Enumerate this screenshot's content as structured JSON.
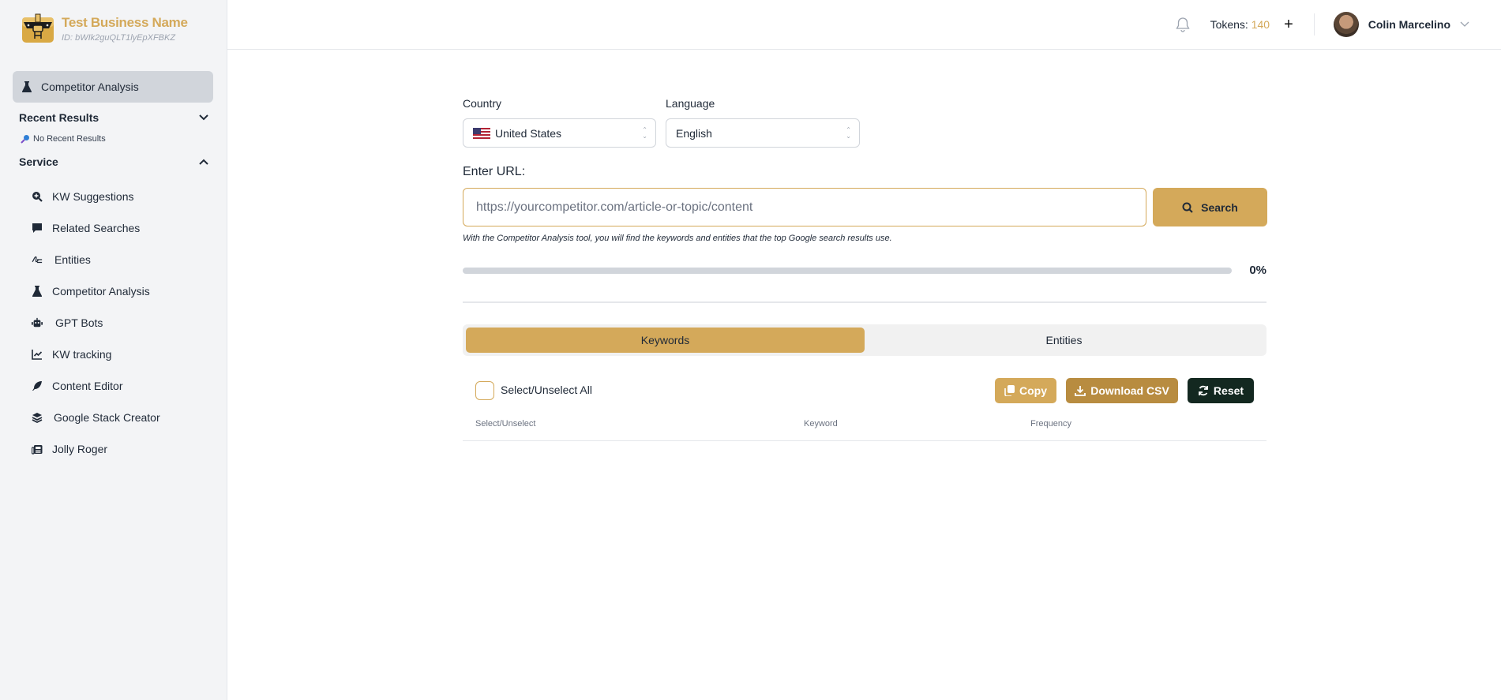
{
  "brand": {
    "name": "Test Business Name",
    "id_text": "ID: bWIk2guQLT1lyEpXFBKZ",
    "logo_icon": "treasure-chest-logo"
  },
  "sidebar": {
    "active_item": {
      "label": "Competitor Analysis",
      "icon": "flask-icon"
    },
    "recent_results": {
      "label": "Recent Results",
      "chevron": "chevron-down-icon",
      "empty_text": "No Recent Results",
      "empty_icon": "key-icon"
    },
    "service": {
      "label": "Service",
      "chevron": "chevron-up-icon"
    },
    "items": [
      {
        "label": "KW Suggestions",
        "icon": "search-plus-icon"
      },
      {
        "label": "Related Searches",
        "icon": "comment-icon"
      },
      {
        "label": "Entities",
        "icon": "signature-icon"
      },
      {
        "label": "Competitor Analysis",
        "icon": "flask-icon"
      },
      {
        "label": "GPT Bots",
        "icon": "robot-icon"
      },
      {
        "label": "KW tracking",
        "icon": "chart-line-icon"
      },
      {
        "label": "Content Editor",
        "icon": "feather-icon"
      },
      {
        "label": "Google Stack Creator",
        "icon": "layers-icon"
      },
      {
        "label": "Jolly Roger",
        "icon": "newspaper-icon"
      }
    ]
  },
  "header": {
    "tokens_label": "Tokens:",
    "tokens_value": "140",
    "user_name": "Colin Marcelino"
  },
  "form": {
    "country_label": "Country",
    "country_value": "United States",
    "language_label": "Language",
    "language_value": "English",
    "url_label": "Enter URL:",
    "url_placeholder": "https://yourcompetitor.com/article-or-topic/content",
    "url_value": "",
    "search_label": "Search",
    "hint": "With the Competitor Analysis tool, you will find the keywords and entities that the top Google search results use.",
    "progress_percent": 0,
    "progress_text": "0%"
  },
  "tabs": [
    {
      "label": "Keywords",
      "active": true
    },
    {
      "label": "Entities",
      "active": false
    }
  ],
  "results": {
    "select_all_label": "Select/Unselect All",
    "select_all_checked": false,
    "copy_label": "Copy",
    "csv_label": "Download CSV",
    "reset_label": "Reset",
    "columns": [
      "Select/Unselect",
      "Keyword",
      "Frequency"
    ],
    "rows": []
  },
  "colors": {
    "accent": "#d4a95a",
    "accent_dark": "#b88c40",
    "reset": "#132820",
    "sidebar_bg": "#f3f4f6"
  }
}
